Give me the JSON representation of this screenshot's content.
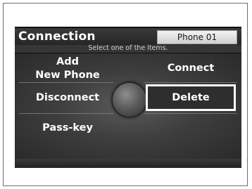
{
  "header": {
    "title": "Connection",
    "phone_label": "Phone 01"
  },
  "subtitle": "Select one of the items.",
  "menu": {
    "add_line1": "Add",
    "add_line2": "New Phone",
    "connect": "Connect",
    "disconnect": "Disconnect",
    "delete": "Delete",
    "passkey": "Pass-key"
  },
  "selected_item": "Delete"
}
